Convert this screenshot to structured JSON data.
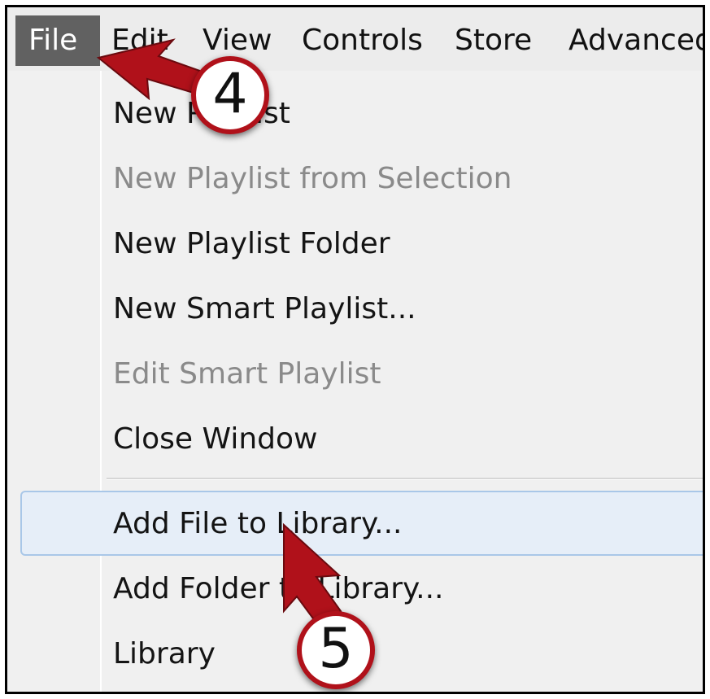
{
  "menu_bar": {
    "items": [
      {
        "label": "File",
        "active": true
      },
      {
        "label": "Edit"
      },
      {
        "label": "View"
      },
      {
        "label": "Controls"
      },
      {
        "label": "Store"
      },
      {
        "label": "Advanced"
      }
    ]
  },
  "file_menu": {
    "items": [
      {
        "label": "New Playlist",
        "enabled": true
      },
      {
        "label": "New Playlist from Selection",
        "enabled": false
      },
      {
        "label": "New Playlist Folder",
        "enabled": true
      },
      {
        "label": "New Smart Playlist...",
        "enabled": true
      },
      {
        "label": "Edit Smart Playlist",
        "enabled": false
      },
      {
        "label": "Close Window",
        "enabled": true
      },
      {
        "label": "Add File to Library...",
        "enabled": true,
        "highlighted": true
      },
      {
        "label": "Add Folder to Library...",
        "enabled": true
      },
      {
        "label": "Library",
        "enabled": true
      }
    ]
  },
  "annotations": {
    "step_4": "4",
    "step_5": "5",
    "color": "#b0111a"
  }
}
